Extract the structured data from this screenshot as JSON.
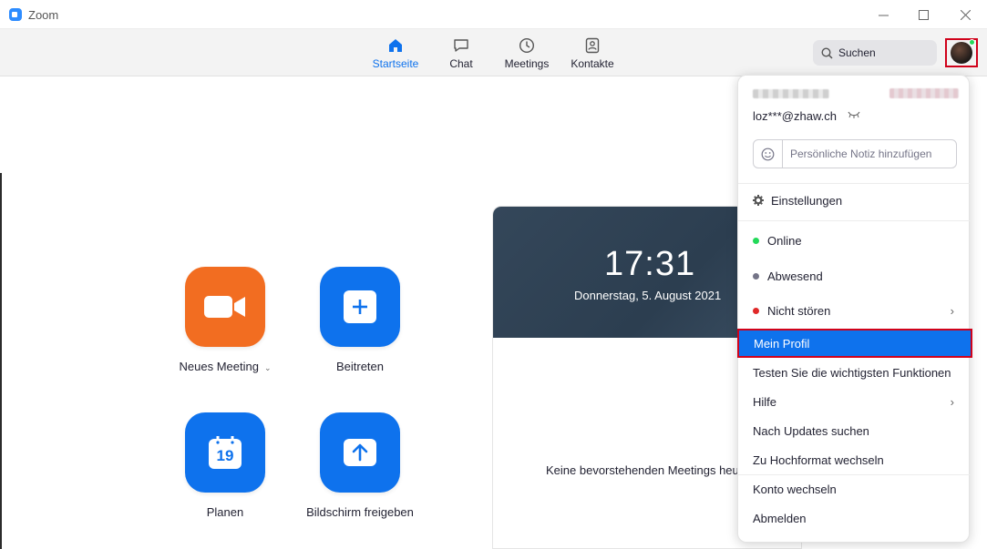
{
  "window": {
    "title": "Zoom"
  },
  "nav": {
    "tabs": [
      {
        "label": "Startseite",
        "icon": "home-icon",
        "active": true
      },
      {
        "label": "Chat",
        "icon": "chat-icon",
        "active": false
      },
      {
        "label": "Meetings",
        "icon": "clock-icon",
        "active": false
      },
      {
        "label": "Kontakte",
        "icon": "contacts-icon",
        "active": false
      }
    ],
    "search_label": "Suchen"
  },
  "actions": [
    {
      "label": "Neues Meeting",
      "icon": "video-camera-icon",
      "color": "#f26d21"
    },
    {
      "label": "Beitreten",
      "icon": "plus-icon",
      "color": "#0e72ed"
    },
    {
      "label": "Planen",
      "icon": "calendar-icon",
      "color": "#0e72ed",
      "calendar_day": "19"
    },
    {
      "label": "Bildschirm freigeben",
      "icon": "share-screen-icon",
      "color": "#0e72ed"
    }
  ],
  "card": {
    "time": "17:31",
    "date": "Donnerstag, 5. August 2021",
    "empty_text": "Keine bevorstehenden Meetings heu"
  },
  "menu": {
    "email": "loz***@zhaw.ch",
    "note_placeholder": "Persönliche Notiz hinzufügen",
    "settings": "Einstellungen",
    "status_online": "Online",
    "status_away": "Abwesend",
    "status_dnd": "Nicht stören",
    "my_profile": "Mein Profil",
    "try_features": "Testen Sie die wichtigsten Funktionen",
    "help": "Hilfe",
    "check_updates": "Nach Updates suchen",
    "portrait_mode": "Zu Hochformat wechseln",
    "switch_account": "Konto wechseln",
    "sign_out": "Abmelden"
  },
  "colors": {
    "accent": "#0e72ed",
    "orange": "#f26d21",
    "online": "#23d959",
    "away": "#747487",
    "dnd": "#e02828",
    "highlight_border": "#d0021b"
  }
}
